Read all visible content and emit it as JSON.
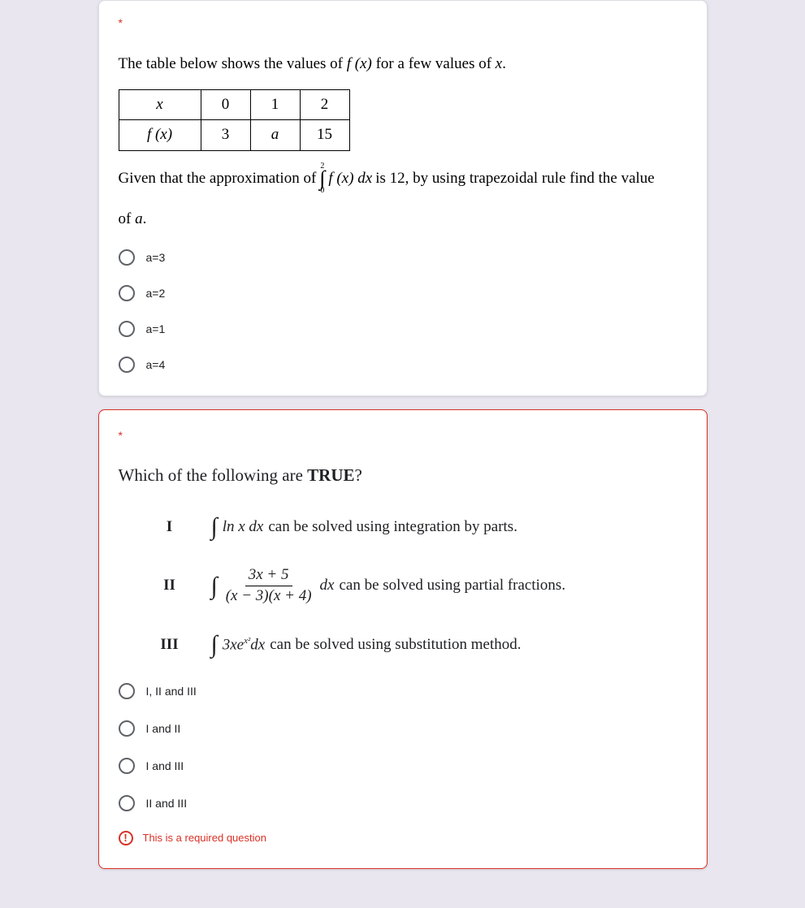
{
  "q1": {
    "required_marker": "*",
    "lead_a": "The table below shows the values of ",
    "lead_fx": "f (x)",
    "lead_b": " for a few values of ",
    "lead_x": "x",
    "lead_c": ".",
    "table": {
      "h_x": "x",
      "h_fx": "f (x)",
      "c0": "0",
      "c1": "1",
      "c2": "2",
      "v0": "3",
      "v1": "a",
      "v2": "15"
    },
    "given_a": "Given that the approximation of ",
    "int_top": "2",
    "int_bot": "0",
    "given_integrand": "f (x) dx",
    "given_b": " is 12, by using trapezoidal rule find the value",
    "of_text": "of ",
    "of_var": "a",
    "of_dot": ".",
    "options": [
      "a=3",
      "a=2",
      "a=1",
      "a=4"
    ]
  },
  "q2": {
    "required_marker": "*",
    "head_a": "Which of the following are ",
    "head_b": "TRUE",
    "head_c": "?",
    "stmts": {
      "r1": "I",
      "s1_expr": "ln x dx",
      "s1_text": " can be solved using integration by parts.",
      "r2": "II",
      "s2_num": "3x + 5",
      "s2_den": "(x − 3)(x + 4)",
      "s2_dx": "dx",
      "s2_text": " can be solved using partial fractions.",
      "r3": "III",
      "s3_a": "3xe",
      "s3_sup": "x²",
      "s3_b": "dx",
      "s3_text": " can be solved using substitution method."
    },
    "options": [
      "I, II and III",
      "I and II",
      "I and III",
      "II and III"
    ],
    "error": "This is a required question",
    "error_icon": "!"
  },
  "chart_data": {
    "type": "table",
    "title": "Values of f(x)",
    "categories": [
      "x",
      "f(x)"
    ],
    "rows": [
      [
        "0",
        "3"
      ],
      [
        "1",
        "a"
      ],
      [
        "2",
        "15"
      ]
    ],
    "note": "Approximation of ∫₀² f(x) dx is 12 (trapezoidal rule)"
  }
}
